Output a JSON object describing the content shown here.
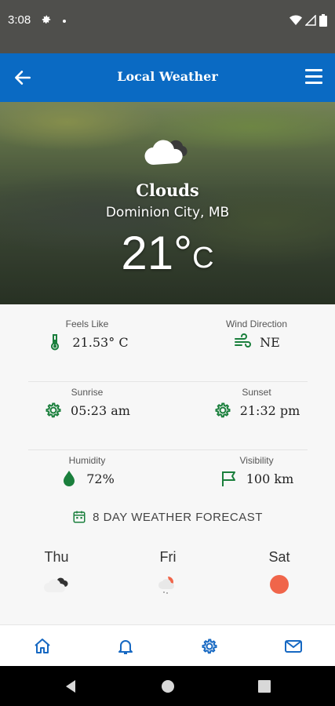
{
  "status_bar": {
    "time": "3:08"
  },
  "app_bar": {
    "title": "Local Weather"
  },
  "hero": {
    "condition": "Clouds",
    "location": "Dominion City, MB",
    "temp_value": "21°",
    "temp_unit": "C"
  },
  "stats": {
    "feels_like": {
      "label": "Feels Like",
      "value": "21.53° C"
    },
    "wind_direction": {
      "label": "Wind Direction",
      "value": "NE"
    },
    "sunrise": {
      "label": "Sunrise",
      "value": "05:23 am"
    },
    "sunset": {
      "label": "Sunset",
      "value": "21:32 pm"
    },
    "humidity": {
      "label": "Humidity",
      "value": "72%"
    },
    "visibility": {
      "label": "Visibility",
      "value": "100 km"
    }
  },
  "forecast": {
    "title": "8 DAY WEATHER FORECAST",
    "days": [
      {
        "name": "Thu",
        "icon": "cloudy-icon"
      },
      {
        "name": "Fri",
        "icon": "partly-rain-icon"
      },
      {
        "name": "Sat",
        "icon": "sun-icon"
      }
    ]
  },
  "colors": {
    "app_bar": "#0a6ac3",
    "accent_green": "#1a7f3c",
    "nav_blue": "#1668c2",
    "sun": "#f0654a"
  },
  "bottom_nav": {
    "items": [
      "home-icon",
      "bell-icon",
      "gear-icon",
      "mail-icon"
    ]
  }
}
